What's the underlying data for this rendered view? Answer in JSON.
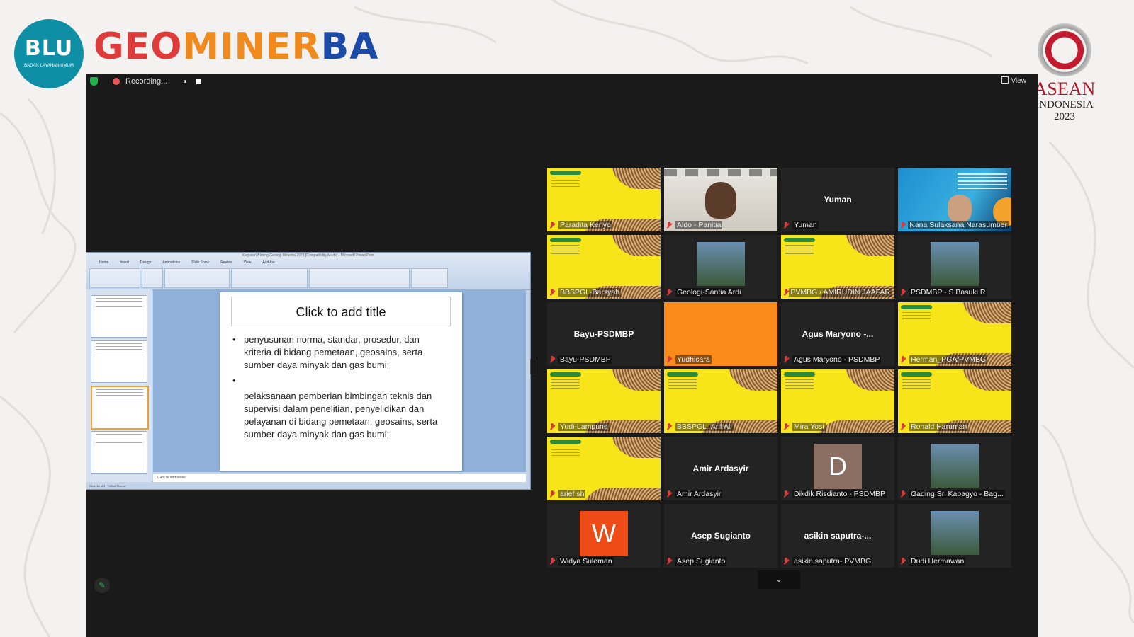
{
  "branding": {
    "blu_logo_text": "BLU",
    "blu_logo_sub": "BADAN LAYANAN UMUM",
    "brand_part1": "GEO",
    "brand_part2": "MINER",
    "brand_part3": "BA",
    "asean_name": "ASEAN",
    "asean_country": "INDONESIA",
    "asean_year": "2023"
  },
  "toolbar": {
    "recording_label": "Recording...",
    "pause_icon": "⏸",
    "view_label": "View"
  },
  "shared_screen": {
    "window_title": "Kegiatan Bidang Geologi Minerba 2023 [Compatibility Mode] - Microsoft PowerPoint",
    "ribbon_tabs": [
      "Home",
      "Insert",
      "Design",
      "Animations",
      "Slide Show",
      "Review",
      "View",
      "Add-Ins"
    ],
    "slide_title": "Click to add title",
    "bullet1": "penyusunan norma, standar, prosedur, dan kriteria di bidang pemetaan, geosains, serta sumber daya  minyak dan gas bumi;",
    "bullet2_text": "pelaksanaan pemberian bimbingan teknis dan supervisi dalam penelitian, penyelidikan dan pelayanan di bidang pemetaan, geosains, serta sumber daya minyak dan gas bumi;",
    "notes_placeholder": "Click to add notes",
    "status_text": "Slide 18 of 37    \"Office Theme\""
  },
  "participants": [
    {
      "name": "Paradita Kenyo",
      "type": "yellow"
    },
    {
      "name": "Aldo - Panitia",
      "type": "camera"
    },
    {
      "name": "Yuman",
      "type": "name",
      "display": "Yuman"
    },
    {
      "name": "Nana Sulaksana Narasumber",
      "type": "speaker"
    },
    {
      "name": "BBSPGL-Barsyah",
      "type": "yellow"
    },
    {
      "name": "Geologi-Santia Ardi",
      "type": "photo"
    },
    {
      "name": "PVMBG / AMIRUDIN JAAFAR",
      "type": "yellow"
    },
    {
      "name": "PSDMBP - S Basuki R",
      "type": "photo"
    },
    {
      "name": "Bayu-PSDMBP",
      "type": "name",
      "display": "Bayu-PSDMBP"
    },
    {
      "name": "Yudhicara",
      "type": "orange"
    },
    {
      "name": "Agus Maryono - PSDMBP",
      "type": "name",
      "display": "Agus Maryono -..."
    },
    {
      "name": "Herman_PGA/PVMBG",
      "type": "yellow"
    },
    {
      "name": "Yudi-Lampung",
      "type": "yellow"
    },
    {
      "name": "BBSPGL_Arif Ali",
      "type": "yellow"
    },
    {
      "name": "Mira Yosi",
      "type": "yellow"
    },
    {
      "name": "Ronald Haruman",
      "type": "yellow"
    },
    {
      "name": "arief sh",
      "type": "yellow"
    },
    {
      "name": "Amir Ardasyir",
      "type": "name",
      "display": "Amir Ardasyir"
    },
    {
      "name": "Dikdik Risdianto - PSDMBP",
      "type": "avatar",
      "letter": "D",
      "color": "#8a6e62"
    },
    {
      "name": "Gading Sri Kabagyo - Bag...",
      "type": "photo"
    },
    {
      "name": "Widya Suleman",
      "type": "avatar",
      "letter": "W",
      "color": "#ee4b18"
    },
    {
      "name": "Asep Sugianto",
      "type": "name",
      "display": "Asep Sugianto"
    },
    {
      "name": "asikin saputra- PVMBG",
      "type": "name",
      "display": "asikin  saputra-..."
    },
    {
      "name": "Dudi Hermawan",
      "type": "photo"
    }
  ],
  "more_icon": "chevron-down-icon",
  "colors": {
    "active_speaker": "#b8e04a",
    "zoom_bg": "#1a1a1a",
    "muted_mic": "#d63b3b"
  }
}
